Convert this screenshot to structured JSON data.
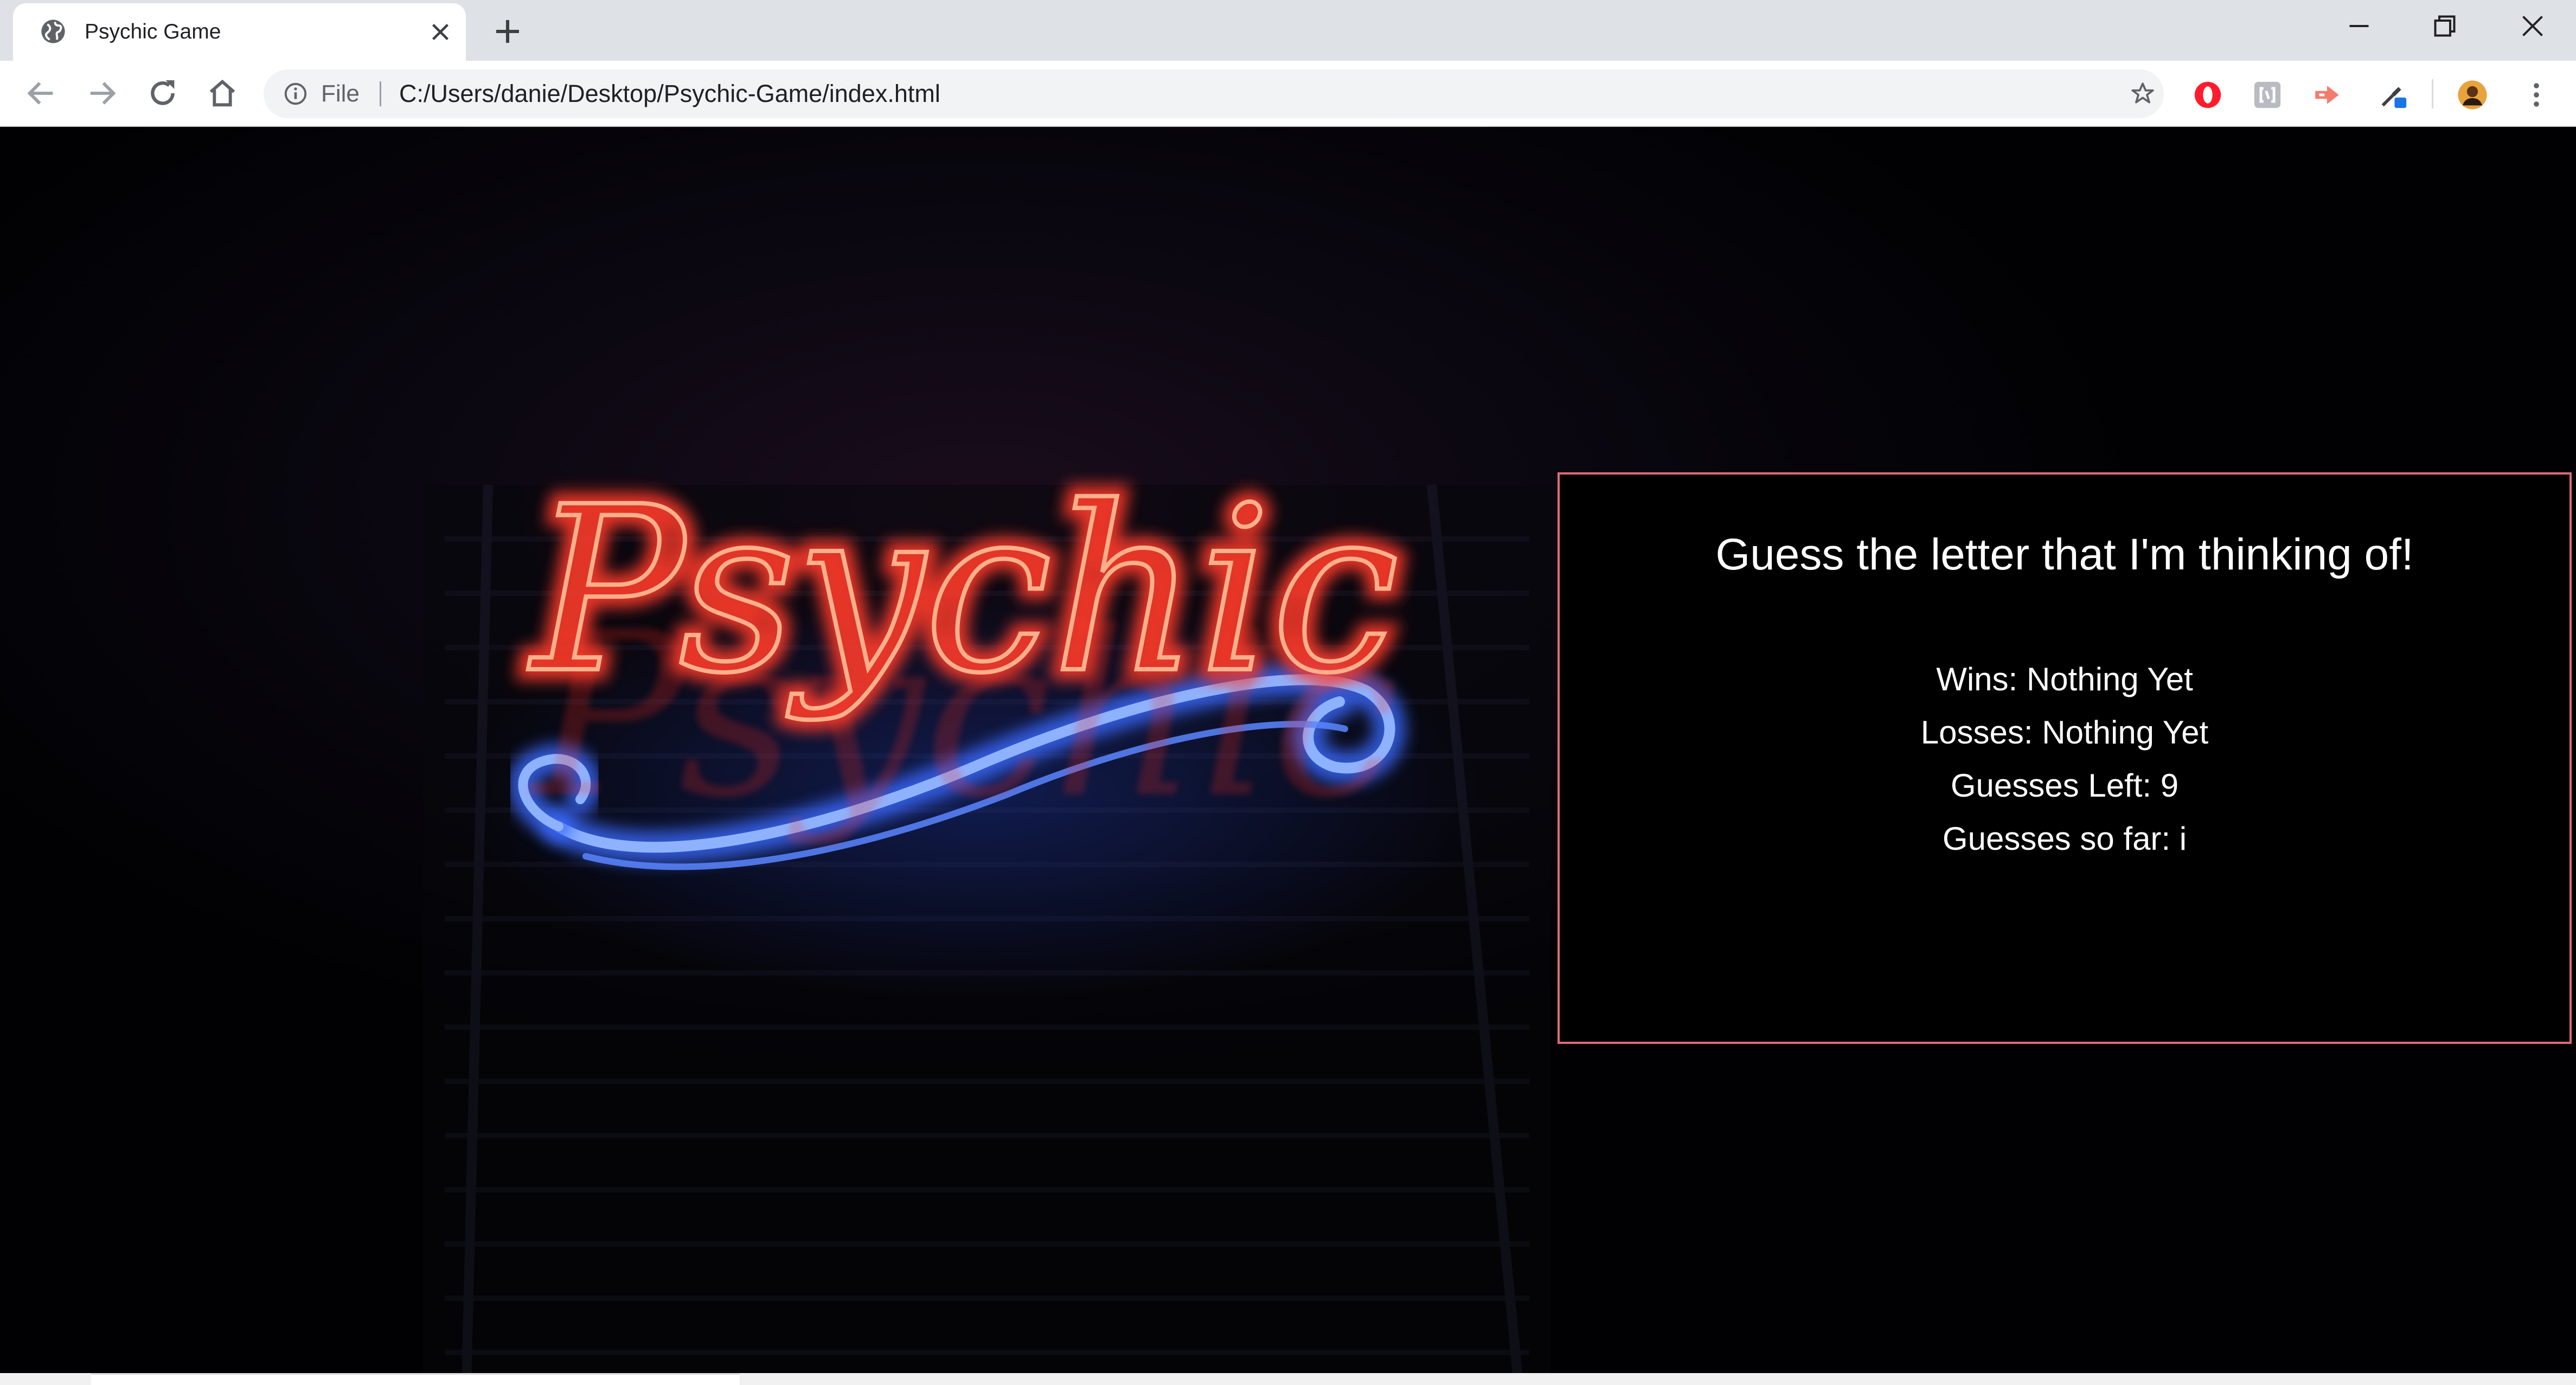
{
  "browser": {
    "tab_title": "Psychic Game",
    "address": {
      "scheme_label": "File",
      "url": "C:/Users/danie/Desktop/Psychic-Game/index.html"
    },
    "icons": {
      "favicon": "globe-icon",
      "tab_close": "close-icon",
      "new_tab": "plus-icon",
      "back": "arrow-left-icon",
      "forward": "arrow-right-icon",
      "reload": "reload-icon",
      "home": "home-icon",
      "info": "info-icon",
      "bookmark": "star-icon",
      "extensions": [
        "opera-icon",
        "bracket-icon",
        "share-arrow-icon",
        "eyedropper-icon"
      ],
      "profile": "avatar",
      "menu": "kebab-menu-icon",
      "minimize": "minimize-icon",
      "restore": "restore-icon",
      "close_window": "close-icon"
    },
    "colors": {
      "tabstrip": "#dee1e6",
      "omnibox": "#f1f3f4",
      "opera_red": "#ff1b2d",
      "share_salmon": "#f47c6c"
    }
  },
  "page": {
    "background_sign_text": "Psychic",
    "game": {
      "title": "Guess the letter that I'm thinking of!",
      "wins": "Wins: Nothing Yet",
      "losses": "Losses: Nothing Yet",
      "guesses_left": "Guesses Left: 9",
      "guesses_so_far": "Guesses so far: i"
    },
    "colors": {
      "box_border": "#e06c78",
      "neon_red": "#ff3b2a",
      "neon_blue": "#3d6bff",
      "text": "#ffffff"
    }
  }
}
